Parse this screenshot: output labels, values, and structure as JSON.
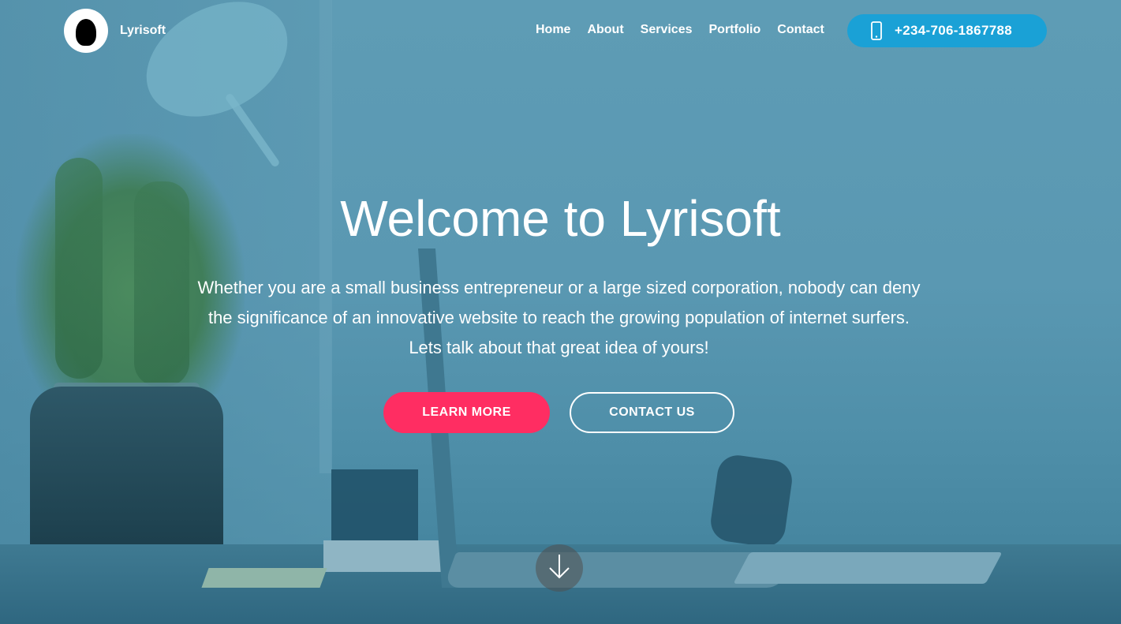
{
  "header": {
    "brand": "Lyrisoft",
    "logo_icon": "silhouette-head-icon",
    "nav": [
      {
        "label": "Home"
      },
      {
        "label": "About"
      },
      {
        "label": "Services"
      },
      {
        "label": "Portfolio"
      },
      {
        "label": "Contact"
      }
    ],
    "phone": {
      "icon": "mobile-phone-icon",
      "number": "+234-706-1867788"
    }
  },
  "hero": {
    "title": "Welcome to Lyrisoft",
    "text": "Whether you are a small business entrepreneur or a large sized corporation, nobody can deny the significance of an innovative website to reach the growing population of internet surfers. Lets talk about that great idea of yours!",
    "learn_more_label": "LEARN MORE",
    "contact_us_label": "CONTACT US",
    "scroll_icon": "arrow-down-icon"
  },
  "colors": {
    "overlay": "#5e9cb5",
    "phone_button": "#1aa1d6",
    "learn_more_button": "#ff2d62",
    "text": "#ffffff"
  }
}
